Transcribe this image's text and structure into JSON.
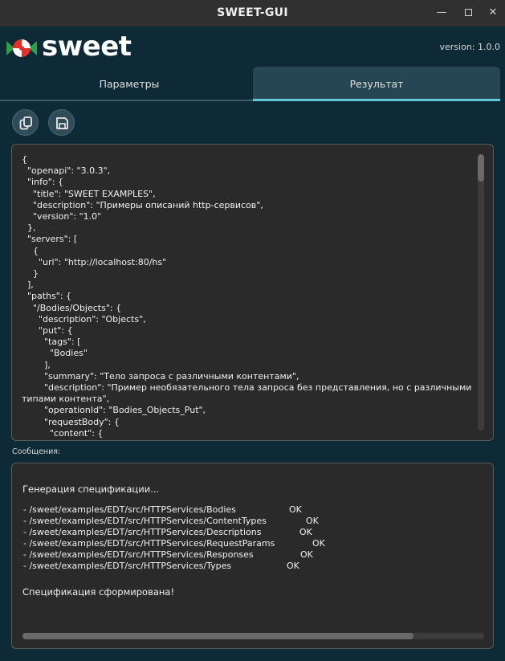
{
  "window": {
    "title": "SWEET-GUI",
    "min_icon": "minimize-icon",
    "max_icon": "maximize-icon",
    "close_icon": "close-icon"
  },
  "brand": {
    "name": "sweet",
    "version": "version: 1.0.0",
    "colors": {
      "red": "#e0312b",
      "green": "#2f9e4a",
      "white": "#ffffff"
    }
  },
  "tabs": [
    {
      "label": "Параметры",
      "active": false
    },
    {
      "label": "Результат",
      "active": true
    }
  ],
  "toolbar": {
    "copy_icon": "copy-icon",
    "save_icon": "save-icon"
  },
  "editor": {
    "content": "{\n  \"openapi\": \"3.0.3\",\n  \"info\": {\n    \"title\": \"SWEET EXAMPLES\",\n    \"description\": \"Примеры описаний http-сервисов\",\n    \"version\": \"1.0\"\n  },\n  \"servers\": [\n    {\n      \"url\": \"http://localhost:80/hs\"\n    }\n  ],\n  \"paths\": {\n    \"/Bodies/Objects\": {\n      \"description\": \"Objects\",\n      \"put\": {\n        \"tags\": [\n          \"Bodies\"\n        ],\n        \"summary\": \"Тело запроса с различными контентами\",\n        \"description\": \"Пример необязательного тела запроса без представления, но с различными типами контента\",\n        \"operationId\": \"Bodies_Objects_Put\",\n        \"requestBody\": {\n          \"content\": {"
  },
  "messages": {
    "label": "Сообщения:",
    "header": "Генерация спецификации...",
    "rows": [
      {
        "path": "- /sweet/examples/EDT/src/HTTPServices/Bodies",
        "status": "OK"
      },
      {
        "path": "- /sweet/examples/EDT/src/HTTPServices/ContentTypes",
        "status": "OK"
      },
      {
        "path": "- /sweet/examples/EDT/src/HTTPServices/Descriptions",
        "status": "OK"
      },
      {
        "path": "- /sweet/examples/EDT/src/HTTPServices/RequestParams",
        "status": "OK"
      },
      {
        "path": "- /sweet/examples/EDT/src/HTTPServices/Responses",
        "status": "OK"
      },
      {
        "path": "- /sweet/examples/EDT/src/HTTPServices/Types",
        "status": "OK"
      }
    ],
    "footer": "Спецификация сформирована!"
  }
}
